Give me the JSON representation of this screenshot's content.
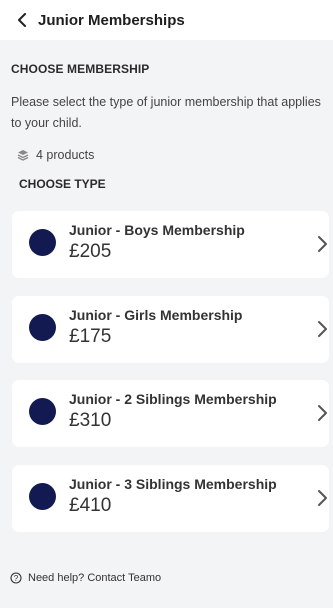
{
  "header": {
    "title": "Junior Memberships"
  },
  "section": {
    "title": "CHOOSE MEMBERSHIP",
    "description": "Please select the type of junior membership that applies to your child.",
    "product_count": "4 products",
    "type_label": "CHOOSE TYPE"
  },
  "products": [
    {
      "name": "Junior - Boys Membership",
      "price": "£205"
    },
    {
      "name": "Junior - Girls Membership",
      "price": "£175"
    },
    {
      "name": "Junior - 2 Siblings Membership",
      "price": "£310"
    },
    {
      "name": "Junior - 3 Siblings Membership",
      "price": "£410"
    }
  ],
  "footer": {
    "help_text": "Need help? Contact Teamo"
  },
  "colors": {
    "accent_dot": "#131a52",
    "background": "#f3f4f6",
    "card": "#ffffff"
  },
  "icons": [
    "back-arrow-icon",
    "layers-icon",
    "chevron-right-icon",
    "help-circle-icon"
  ]
}
